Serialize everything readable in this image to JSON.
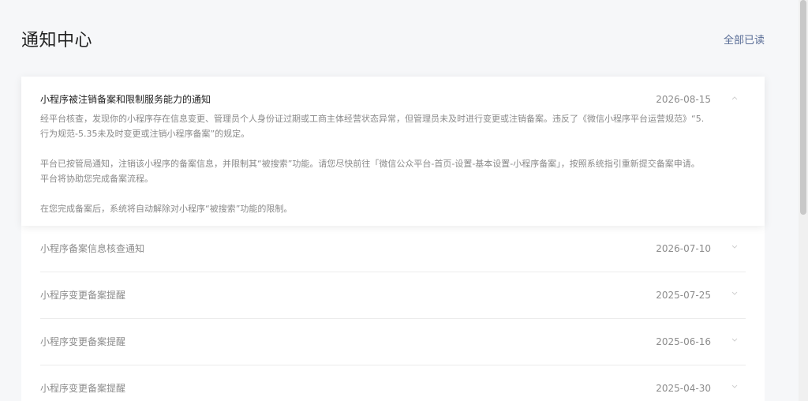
{
  "header": {
    "title": "通知中心",
    "mark_all_read": "全部已读"
  },
  "notifications": [
    {
      "title": "小程序被注销备案和限制服务能力的通知",
      "date": "2026-08-15",
      "expanded": true,
      "body": [
        "经平台核查，发现你的小程序存在信息变更、管理员个人身份证过期或工商主体经营状态异常，但管理员未及时进行变更或注销备案。违反了《微信小程序平台运营规范》“5.",
        "行为规范-5.35未及时变更或注销小程序备案”的规定。",
        "平台已按管局通知，注销该小程序的备案信息，并限制其“被搜索”功能。请您尽快前往「微信公众平台-首页-设置-基本设置-小程序备案」，按照系统指引重新提交备案申请。",
        "平台将协助您完成备案流程。",
        "在您完成备案后，系统将自动解除对小程序“被搜索”功能的限制。"
      ]
    },
    {
      "title": "小程序备案信息核查通知",
      "date": "2026-07-10",
      "expanded": false
    },
    {
      "title": "小程序变更备案提醒",
      "date": "2025-07-25",
      "expanded": false
    },
    {
      "title": "小程序变更备案提醒",
      "date": "2025-06-16",
      "expanded": false
    },
    {
      "title": "小程序变更备案提醒",
      "date": "2025-04-30",
      "expanded": false
    }
  ],
  "colors": {
    "link": "#576b95",
    "background": "#f6f7f9"
  }
}
